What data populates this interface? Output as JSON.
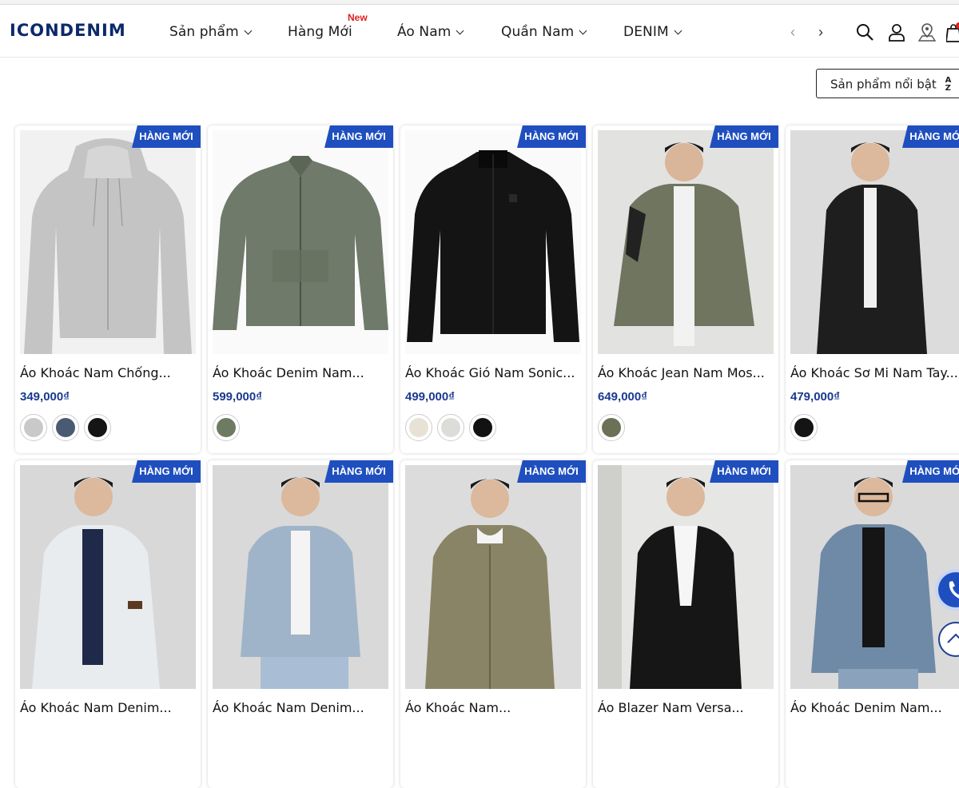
{
  "header": {
    "logo": "ICONDENIM",
    "nav": [
      {
        "label": "Sản phẩm"
      },
      {
        "label": "Hàng Mới",
        "badge": "New"
      },
      {
        "label": "Áo Nam"
      },
      {
        "label": "Quần Nam"
      },
      {
        "label": "DENIM"
      }
    ],
    "prev_arrow": "‹",
    "next_arrow": "›",
    "icons": [
      "search-icon",
      "user-icon",
      "location-icon",
      "cart-icon"
    ]
  },
  "sort": {
    "label": "Sản phẩm nổi bật",
    "icon": "sort-az-icon"
  },
  "products": [
    {
      "badge": "HÀNG MỚI",
      "name": "Áo Khoác Nam Chống...",
      "price": "349,000₫",
      "swatches": [
        "#c9c9c9",
        "#4a5a72",
        "#151515"
      ]
    },
    {
      "badge": "HÀNG MỚI",
      "name": "Áo Khoác Denim Nam...",
      "price": "599,000₫",
      "swatches": [
        "#6e7a62"
      ]
    },
    {
      "badge": "HÀNG MỚI",
      "name": "Áo Khoác Gió Nam Sonic...",
      "price": "499,000₫",
      "swatches": [
        "#e8e2d6",
        "#dcdcd8",
        "#121212"
      ]
    },
    {
      "badge": "HÀNG MỚI",
      "name": "Áo Khoác Jean Nam Mos...",
      "price": "649,000₫",
      "swatches": [
        "#6b7156"
      ]
    },
    {
      "badge": "HÀNG MỚI",
      "name": "Áo Khoác Sơ Mi Nam Tay...",
      "price": "479,000₫",
      "swatches": [
        "#141414"
      ]
    },
    {
      "badge": "HÀNG MỚI",
      "name": "Áo Khoác Nam Denim..."
    },
    {
      "badge": "HÀNG MỚI",
      "name": "Áo Khoác Nam Denim..."
    },
    {
      "badge": "HÀNG MỚI",
      "name": "Áo Khoác Nam..."
    },
    {
      "badge": "HÀNG MỚI",
      "name": "Áo Blazer Nam Versa..."
    },
    {
      "badge": "HÀNG MỚI",
      "name": "Áo Khoác Denim Nam..."
    }
  ],
  "colors": {
    "brand": "#0b2a6b",
    "badge": "#1f4fbf",
    "price": "#1a3a8f",
    "new": "#e02020"
  },
  "floating": [
    "phone-icon",
    "scroll-top-icon"
  ]
}
